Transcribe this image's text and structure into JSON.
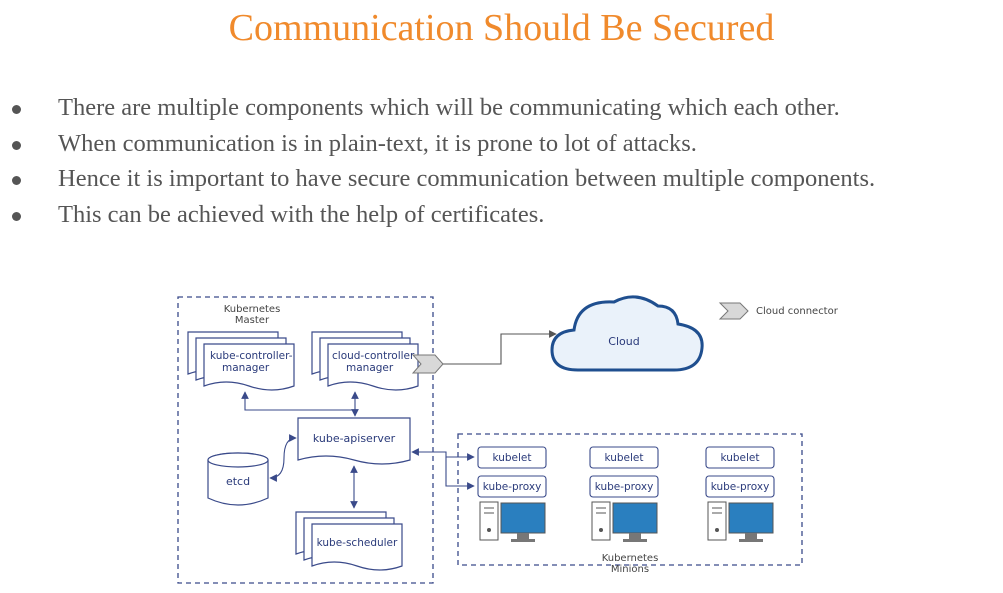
{
  "title": "Communication Should Be Secured",
  "bullets": [
    "There are multiple components which will be communicating which each other.",
    "When communication is in plain-text, it is prone to lot of attacks.",
    "Hence it is important to have secure communication between multiple components.",
    "This can be achieved with the help of certificates."
  ],
  "diagram": {
    "master_label_1": "Kubernetes",
    "master_label_2": "Master",
    "kcm_1": "kube-controller-",
    "kcm_2": "manager",
    "ccm_1": "cloud-controller-",
    "ccm_2": "manager",
    "apiserver": "kube-apiserver",
    "etcd": "etcd",
    "scheduler": "kube-scheduler",
    "cloud": "Cloud",
    "legend": "Cloud connector",
    "kubelet": "kubelet",
    "kube_proxy": "kube-proxy",
    "minions_label_1": "Kubernetes",
    "minions_label_2": "Minions"
  },
  "colors": {
    "title": "#f08a2c",
    "body_text": "#555555",
    "diagram_stroke": "#3a4a8a",
    "monitor": "#2a7fbf"
  }
}
